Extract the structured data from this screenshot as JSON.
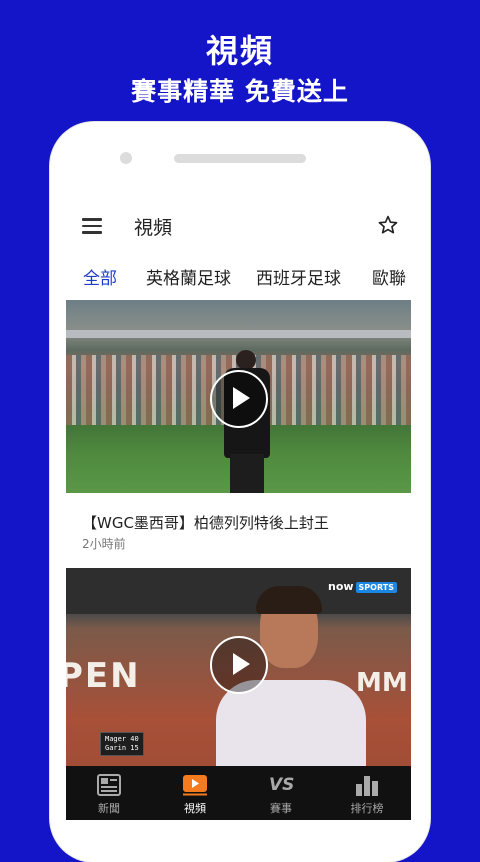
{
  "promo": {
    "title": "視頻",
    "subtitle": "賽事精華  免費送上"
  },
  "appbar": {
    "title": "視頻"
  },
  "tabs": [
    {
      "label": "全部",
      "active": true
    },
    {
      "label": "英格蘭足球",
      "active": false
    },
    {
      "label": "西班牙足球",
      "active": false
    },
    {
      "label": "歐聯",
      "active": false
    }
  ],
  "articles": [
    {
      "title": "【WGC墨西哥】柏德列列特後上封王",
      "time": "2小時前"
    }
  ],
  "video2": {
    "banner_left": "PEN",
    "banner_right": "MM",
    "brand": "now",
    "brand_tag": "SPORTS",
    "score": {
      "p1": "Mager",
      "p1_pts": "40",
      "p2": "Garin",
      "p2_pts": "15"
    }
  },
  "bottom_nav": [
    {
      "label": "新聞",
      "icon": "newspaper-icon",
      "active": false
    },
    {
      "label": "視頻",
      "icon": "video-icon",
      "active": true
    },
    {
      "label": "賽事",
      "icon": "vs-icon",
      "active": false
    },
    {
      "label": "排行榜",
      "icon": "bar-chart-icon",
      "active": false
    }
  ],
  "colors": {
    "background": "#1414c8",
    "accent": "#1e3cc8",
    "video_icon": "#f47c1e",
    "nav_bg": "#111111"
  }
}
